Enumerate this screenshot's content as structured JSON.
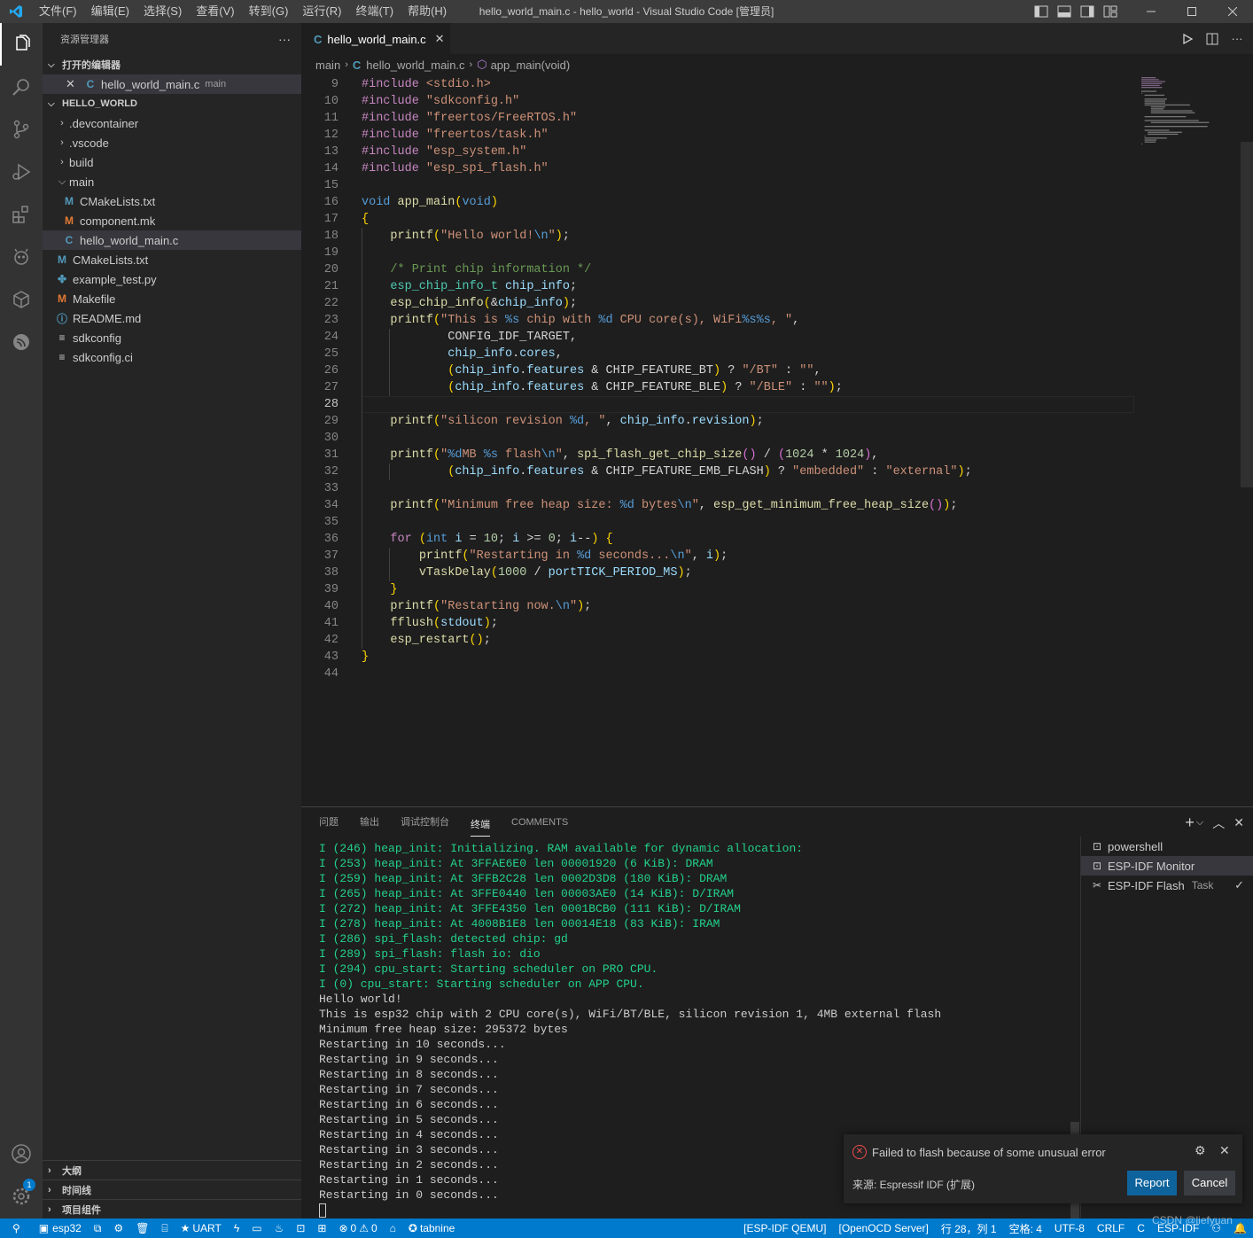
{
  "menu": [
    "文件(F)",
    "编辑(E)",
    "选择(S)",
    "查看(V)",
    "转到(G)",
    "运行(R)",
    "终端(T)",
    "帮助(H)"
  ],
  "window_title": "hello_world_main.c - hello_world - Visual Studio Code [管理员]",
  "sidebar": {
    "title": "资源管理器",
    "more": "···",
    "open_editors_header": "打开的编辑器",
    "open_editor": {
      "name": "hello_world_main.c",
      "desc": "main"
    },
    "project_header": "HELLO_WORLD",
    "tree": [
      {
        "label": ".devcontainer",
        "icon": "chevron-right"
      },
      {
        "label": ".vscode",
        "icon": "chevron-right"
      },
      {
        "label": "build",
        "icon": "chevron-right"
      },
      {
        "label": "main",
        "icon": "chevron-down"
      },
      {
        "label": "CMakeLists.txt",
        "icon": "cmake-icon"
      },
      {
        "label": "component.mk",
        "icon": "makefile-icon"
      },
      {
        "label": "hello_world_main.c",
        "icon": "c-file-icon"
      },
      {
        "label": "CMakeLists.txt",
        "icon": "cmake-icon"
      },
      {
        "label": "example_test.py",
        "icon": "python-icon"
      },
      {
        "label": "Makefile",
        "icon": "makefile-icon"
      },
      {
        "label": "README.md",
        "icon": "info-icon"
      },
      {
        "label": "sdkconfig",
        "icon": "lines-icon"
      },
      {
        "label": "sdkconfig.ci",
        "icon": "lines-icon"
      }
    ],
    "bottom_sections": [
      "大纲",
      "时间线",
      "项目组件"
    ]
  },
  "tab": {
    "label": "hello_world_main.c",
    "icon": "C"
  },
  "breadcrumb": [
    "main",
    "hello_world_main.c",
    "app_main(void)"
  ],
  "editor": {
    "current_line": 28,
    "lines": [
      [
        9,
        "#include <stdio.h>"
      ],
      [
        10,
        "#include \"sdkconfig.h\""
      ],
      [
        11,
        "#include \"freertos/FreeRTOS.h\""
      ],
      [
        12,
        "#include \"freertos/task.h\""
      ],
      [
        13,
        "#include \"esp_system.h\""
      ],
      [
        14,
        "#include \"esp_spi_flash.h\""
      ],
      [
        15,
        ""
      ],
      [
        16,
        "void app_main(void)"
      ],
      [
        17,
        "{"
      ],
      [
        18,
        "    printf(\"Hello world!\\n\");"
      ],
      [
        19,
        ""
      ],
      [
        20,
        "    /* Print chip information */"
      ],
      [
        21,
        "    esp_chip_info_t chip_info;"
      ],
      [
        22,
        "    esp_chip_info(&chip_info);"
      ],
      [
        23,
        "    printf(\"This is %s chip with %d CPU core(s), WiFi%s%s, \","
      ],
      [
        24,
        "            CONFIG_IDF_TARGET,"
      ],
      [
        25,
        "            chip_info.cores,"
      ],
      [
        26,
        "            (chip_info.features & CHIP_FEATURE_BT) ? \"/BT\" : \"\","
      ],
      [
        27,
        "            (chip_info.features & CHIP_FEATURE_BLE) ? \"/BLE\" : \"\");"
      ],
      [
        28,
        ""
      ],
      [
        29,
        "    printf(\"silicon revision %d, \", chip_info.revision);"
      ],
      [
        30,
        ""
      ],
      [
        31,
        "    printf(\"%dMB %s flash\\n\", spi_flash_get_chip_size() / (1024 * 1024),"
      ],
      [
        32,
        "            (chip_info.features & CHIP_FEATURE_EMB_FLASH) ? \"embedded\" : \"external\");"
      ],
      [
        33,
        ""
      ],
      [
        34,
        "    printf(\"Minimum free heap size: %d bytes\\n\", esp_get_minimum_free_heap_size());"
      ],
      [
        35,
        ""
      ],
      [
        36,
        "    for (int i = 10; i >= 0; i--) {"
      ],
      [
        37,
        "        printf(\"Restarting in %d seconds...\\n\", i);"
      ],
      [
        38,
        "        vTaskDelay(1000 / portTICK_PERIOD_MS);"
      ],
      [
        39,
        "    }"
      ],
      [
        40,
        "    printf(\"Restarting now.\\n\");"
      ],
      [
        41,
        "    fflush(stdout);"
      ],
      [
        42,
        "    esp_restart();"
      ],
      [
        43,
        "}"
      ],
      [
        44,
        ""
      ]
    ]
  },
  "panel": {
    "tabs": [
      "问题",
      "输出",
      "调试控制台",
      "终端",
      "COMMENTS"
    ],
    "active_tab": "终端",
    "terminal_lines": [
      [
        "g",
        "I (246) heap_init: Initializing. RAM available for dynamic allocation:"
      ],
      [
        "g",
        "I (253) heap_init: At 3FFAE6E0 len 00001920 (6 KiB): DRAM"
      ],
      [
        "g",
        "I (259) heap_init: At 3FFB2C28 len 0002D3D8 (180 KiB): DRAM"
      ],
      [
        "g",
        "I (265) heap_init: At 3FFE0440 len 00003AE0 (14 KiB): D/IRAM"
      ],
      [
        "g",
        "I (272) heap_init: At 3FFE4350 len 0001BCB0 (111 KiB): D/IRAM"
      ],
      [
        "g",
        "I (278) heap_init: At 4008B1E8 len 00014E18 (83 KiB): IRAM"
      ],
      [
        "g",
        "I (286) spi_flash: detected chip: gd"
      ],
      [
        "g",
        "I (289) spi_flash: flash io: dio"
      ],
      [
        "g",
        "I (294) cpu_start: Starting scheduler on PRO CPU."
      ],
      [
        "g",
        "I (0) cpu_start: Starting scheduler on APP CPU."
      ],
      [
        "w",
        "Hello world!"
      ],
      [
        "w",
        "This is esp32 chip with 2 CPU core(s), WiFi/BT/BLE, silicon revision 1, 4MB external flash"
      ],
      [
        "w",
        "Minimum free heap size: 295372 bytes"
      ],
      [
        "w",
        "Restarting in 10 seconds..."
      ],
      [
        "w",
        "Restarting in 9 seconds..."
      ],
      [
        "w",
        "Restarting in 8 seconds..."
      ],
      [
        "w",
        "Restarting in 7 seconds..."
      ],
      [
        "w",
        "Restarting in 6 seconds..."
      ],
      [
        "w",
        "Restarting in 5 seconds..."
      ],
      [
        "w",
        "Restarting in 4 seconds..."
      ],
      [
        "w",
        "Restarting in 3 seconds..."
      ],
      [
        "w",
        "Restarting in 2 seconds..."
      ],
      [
        "w",
        "Restarting in 1 seconds..."
      ],
      [
        "w",
        "Restarting in 0 seconds..."
      ]
    ],
    "terminals": [
      {
        "name": "powershell",
        "task": ""
      },
      {
        "name": "ESP-IDF Monitor",
        "task": ""
      },
      {
        "name": "ESP-IDF Flash",
        "task": "Task"
      }
    ]
  },
  "notification": {
    "message": "Failed to flash because of some unusual error",
    "source": "来源: Espressif IDF (扩展)",
    "report": "Report",
    "cancel": "Cancel"
  },
  "statusbar": {
    "left": [
      "esp32",
      "UART",
      "0",
      "0",
      "tabnine"
    ],
    "right": [
      "[ESP-IDF QEMU]",
      "[OpenOCD Server]",
      "行 28，列 1",
      "空格: 4",
      "UTF-8",
      "CRLF",
      "C",
      "ESP-IDF"
    ]
  },
  "watermark": "CSDN @liefyuan",
  "colors": {
    "accent": "#007acc",
    "terminal_green": "#23d18b",
    "error": "#f14c4c"
  }
}
